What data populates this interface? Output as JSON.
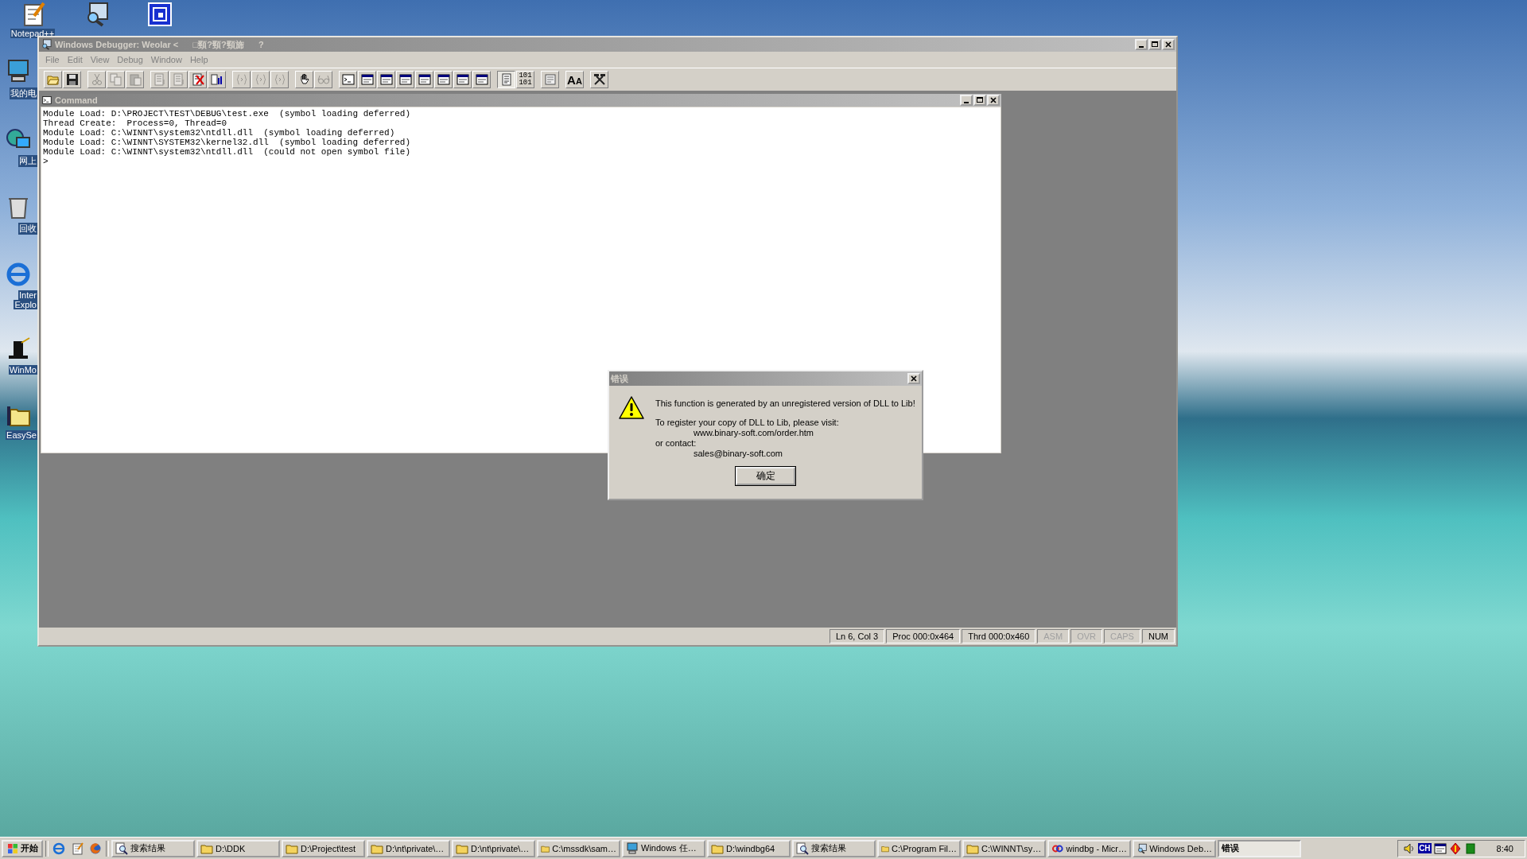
{
  "desktop": {
    "top_icons": [
      {
        "kind": "notepad",
        "label": "Notepad++"
      },
      {
        "kind": "debugger"
      },
      {
        "kind": "studio"
      }
    ],
    "side_icons": [
      {
        "kind": "computer",
        "lines": [
          "我的电"
        ]
      },
      {
        "kind": "network",
        "lines": [
          "网上"
        ]
      },
      {
        "kind": "recycle",
        "lines": [
          "回收"
        ]
      },
      {
        "kind": "ie",
        "lines": [
          "Inter",
          "Explo"
        ]
      },
      {
        "kind": "hat",
        "lines": [
          "WinMo"
        ]
      },
      {
        "kind": "easy",
        "lines": [
          "EasySe"
        ]
      }
    ]
  },
  "window": {
    "title": "Windows Debugger: Weolar <      □頸?頸?頸旆      ?",
    "menu": [
      "File",
      "Edit",
      "View",
      "Debug",
      "Window",
      "Help"
    ],
    "toolbar": [
      [
        {
          "kind": "open",
          "disabled": false,
          "pressed": false
        },
        {
          "kind": "save",
          "disabled": false,
          "pressed": false
        }
      ],
      [
        {
          "kind": "cut",
          "disabled": true,
          "pressed": false
        },
        {
          "kind": "copy",
          "disabled": true,
          "pressed": false
        },
        {
          "kind": "paste",
          "disabled": true,
          "pressed": false
        }
      ],
      [
        {
          "kind": "doclist",
          "disabled": true,
          "pressed": false
        },
        {
          "kind": "doclist",
          "disabled": true,
          "pressed": false
        },
        {
          "kind": "docx",
          "disabled": false,
          "pressed": false
        },
        {
          "kind": "bars",
          "disabled": false,
          "pressed": false
        }
      ],
      [
        {
          "kind": "braces",
          "disabled": true,
          "pressed": false
        },
        {
          "kind": "braces",
          "disabled": true,
          "pressed": false
        },
        {
          "kind": "braces",
          "disabled": true,
          "pressed": false
        }
      ],
      [
        {
          "kind": "hand",
          "disabled": false,
          "pressed": false
        },
        {
          "kind": "glasses",
          "disabled": true,
          "pressed": false
        }
      ],
      [
        {
          "kind": "cmd",
          "disabled": false,
          "pressed": false
        },
        {
          "kind": "win",
          "disabled": false,
          "pressed": false
        },
        {
          "kind": "win",
          "disabled": false,
          "pressed": false
        },
        {
          "kind": "win",
          "disabled": false,
          "pressed": false
        },
        {
          "kind": "win",
          "disabled": false,
          "pressed": false
        },
        {
          "kind": "win",
          "disabled": false,
          "pressed": false
        },
        {
          "kind": "win",
          "disabled": false,
          "pressed": false
        },
        {
          "kind": "win",
          "disabled": false,
          "pressed": false
        }
      ],
      [
        {
          "kind": "source",
          "disabled": false,
          "pressed": true
        },
        {
          "kind": "text",
          "text": "101 101",
          "disabled": false,
          "pressed": false
        }
      ],
      [
        {
          "kind": "options",
          "disabled": false,
          "pressed": false
        }
      ],
      [
        {
          "kind": "font",
          "text": "AA",
          "disabled": false,
          "pressed": false
        }
      ],
      [
        {
          "kind": "tools",
          "disabled": false,
          "pressed": false
        }
      ]
    ],
    "command": {
      "title": "Command",
      "lines": [
        "Module Load: D:\\PROJECT\\TEST\\DEBUG\\test.exe  (symbol loading deferred)",
        "Thread Create:  Process=0, Thread=0",
        "Module Load: C:\\WINNT\\system32\\ntdll.dll  (symbol loading deferred)",
        "Module Load: C:\\WINNT\\SYSTEM32\\kernel32.dll  (symbol loading deferred)",
        "Module Load: C:\\WINNT\\system32\\ntdll.dll  (could not open symbol file)"
      ],
      "prompt": ">"
    },
    "status_bar": [
      {
        "text": "Ln 6, Col 3",
        "on": true
      },
      {
        "text": "Proc 000:0x464",
        "on": true
      },
      {
        "text": "Thrd 000:0x460",
        "on": true
      },
      {
        "text": "ASM",
        "on": false
      },
      {
        "text": "OVR",
        "on": false
      },
      {
        "text": "CAPS",
        "on": false
      },
      {
        "text": "NUM",
        "on": true
      }
    ]
  },
  "dialog": {
    "title": "错误",
    "message": "This function is generated by an unregistered version of DLL to Lib!",
    "details": [
      {
        "text": "To register your copy of DLL to Lib, please visit:",
        "indent": false
      },
      {
        "text": "www.binary-soft.com/order.htm",
        "indent": true
      },
      {
        "text": "or contact:",
        "indent": false
      },
      {
        "text": "sales@binary-soft.com",
        "indent": true
      }
    ],
    "button": "确定"
  },
  "taskbar": {
    "start": "开始",
    "tasks": [
      {
        "label": "搜索结果",
        "selected": false
      },
      {
        "label": "D:\\DDK",
        "selected": false
      },
      {
        "label": "D:\\Project\\test",
        "selected": false
      },
      {
        "label": "D:\\nt\\private\\…",
        "selected": false
      },
      {
        "label": "D:\\nt\\private\\…",
        "selected": false
      },
      {
        "label": "C:\\mssdk\\sam…",
        "selected": false
      },
      {
        "label": "Windows 任…",
        "selected": false
      },
      {
        "label": "D:\\windbg64",
        "selected": false
      },
      {
        "label": "搜索结果",
        "selected": false
      },
      {
        "label": "C:\\Program Fil…",
        "selected": false
      },
      {
        "label": "C:\\WINNT\\sy…",
        "selected": false
      },
      {
        "label": "windbg - Micr…",
        "selected": false
      },
      {
        "label": "Windows Deb…",
        "selected": false
      },
      {
        "label": "错误",
        "selected": true
      }
    ],
    "tray": {
      "ime": "CH",
      "clock": "8:40"
    }
  }
}
